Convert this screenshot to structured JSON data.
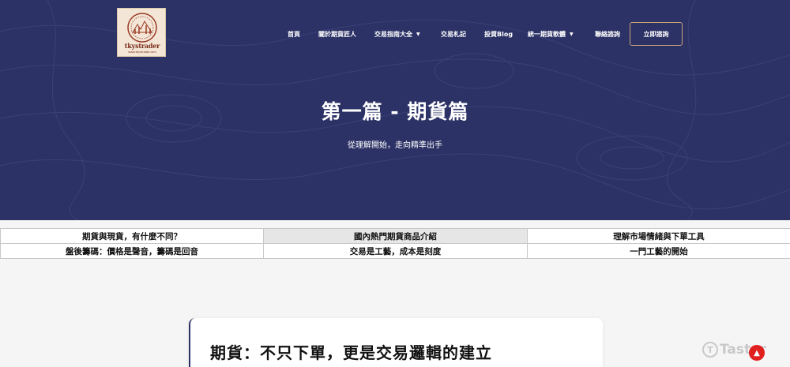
{
  "brand": {
    "name": "tkystrader",
    "sub": "www.tkystrader.com"
  },
  "nav": {
    "items": [
      {
        "label": "首頁",
        "dropdown": false
      },
      {
        "label": "關於期貨匠人",
        "dropdown": false
      },
      {
        "label": "交易指南大全",
        "dropdown": true
      },
      {
        "label": "交易札記",
        "dropdown": false
      },
      {
        "label": "投資Blog",
        "dropdown": false
      },
      {
        "label": "統一期貨軟體",
        "dropdown": true
      },
      {
        "label": "聯絡諮詢",
        "dropdown": false
      }
    ],
    "cta": "立即諮詢"
  },
  "hero": {
    "title": "第一篇 - 期貨篇",
    "subtitle": "從理解開始，走向精準出手"
  },
  "links": [
    {
      "label": "期貨與現貨，有什麼不同？",
      "active": false
    },
    {
      "label": "國內熱門期貨商品介紹",
      "active": true
    },
    {
      "label": "理解市場情緒與下單工具",
      "active": false
    },
    {
      "label": "盤後籌碼：價格是聲音，籌碼是回音",
      "active": false
    },
    {
      "label": "交易是工藝，成本是刻度",
      "active": false
    },
    {
      "label": "一門工藝的開始",
      "active": false
    }
  ],
  "article": {
    "title": "期貨：不只下單，更是交易邏輯的建立"
  },
  "watermark": "Taster",
  "colors": {
    "hero_bg": "#2c3266",
    "cta_border": "#c8a27a",
    "totop_bg": "#e0201f"
  }
}
